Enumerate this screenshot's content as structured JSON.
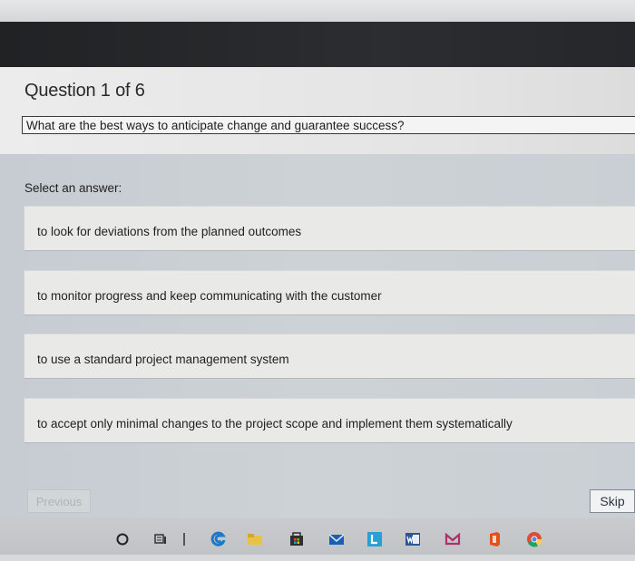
{
  "quiz": {
    "question_number": "Question 1 of 6",
    "question_text": "What are the best ways to anticipate change and guarantee success?",
    "select_label": "Select an answer:",
    "options": [
      {
        "label": "to look for deviations from the planned outcomes"
      },
      {
        "label": "to monitor progress and keep communicating with the customer"
      },
      {
        "label": "to use a standard project management system"
      },
      {
        "label": "to accept only minimal changes to the project scope and implement them systematically"
      }
    ],
    "previous_label": "Previous",
    "skip_label": "Skip"
  },
  "taskbar": {
    "icons": [
      {
        "name": "search-icon"
      },
      {
        "name": "task-view-icon"
      },
      {
        "name": "edge-browser-icon"
      },
      {
        "name": "file-explorer-icon"
      },
      {
        "name": "store-icon"
      },
      {
        "name": "mail-icon"
      },
      {
        "name": "linkedin-learning-icon"
      },
      {
        "name": "word-icon"
      },
      {
        "name": "app-icon"
      },
      {
        "name": "office-icon"
      },
      {
        "name": "chrome-icon"
      }
    ]
  },
  "colors": {
    "title_bar": "#25272a",
    "accent_link": "#2a3440",
    "disabled_text": "#aeb4b8"
  }
}
